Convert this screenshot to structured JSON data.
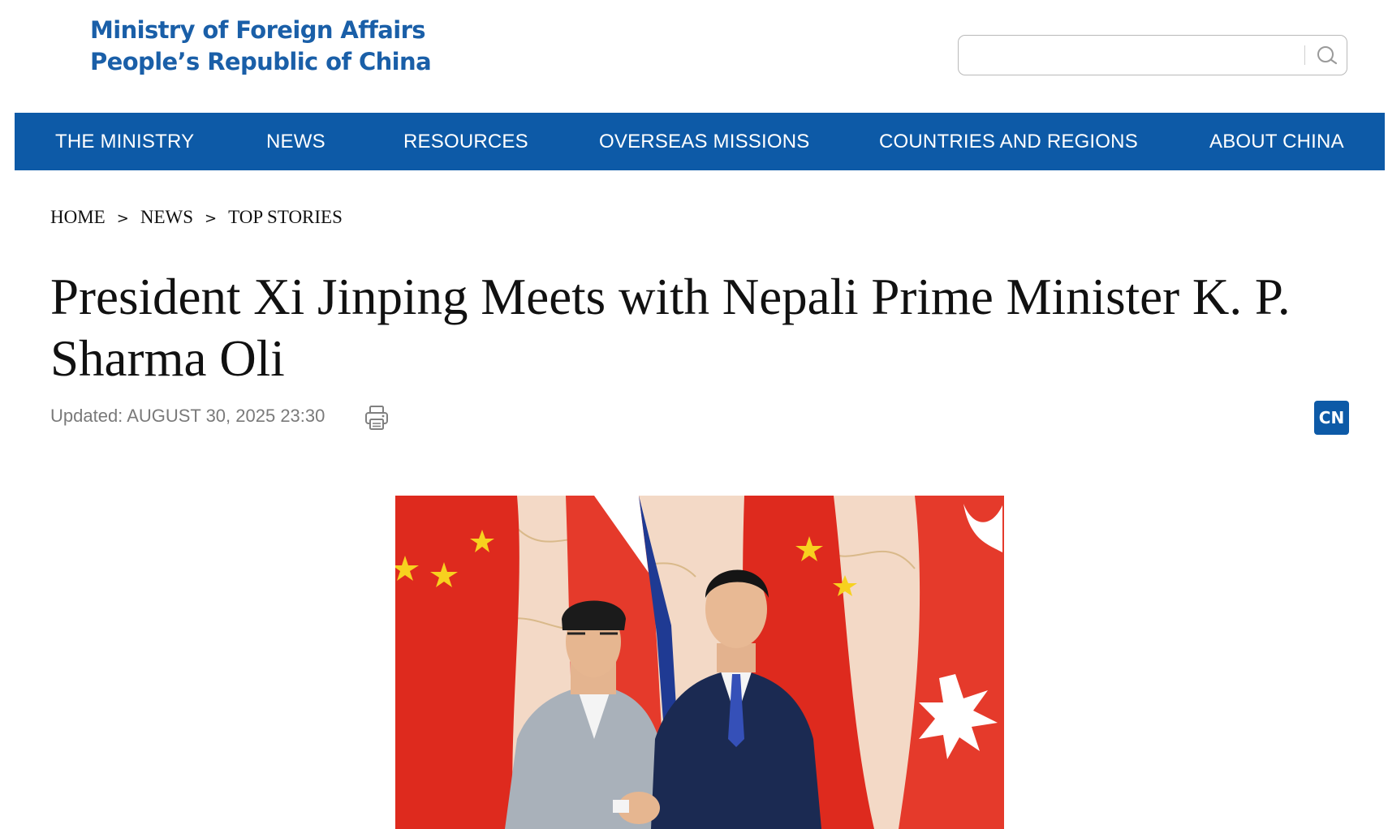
{
  "site": {
    "logo_line1": "Ministry of Foreign Affairs",
    "logo_line2": "People’s Republic of China",
    "brand_color": "#1a5fa8"
  },
  "search": {
    "placeholder": "",
    "value": "",
    "icon": "search-icon"
  },
  "nav": {
    "background": "#0d5aa7",
    "items": [
      {
        "label": "THE MINISTRY"
      },
      {
        "label": "NEWS"
      },
      {
        "label": "RESOURCES"
      },
      {
        "label": "OVERSEAS MISSIONS"
      },
      {
        "label": "COUNTRIES AND REGIONS"
      },
      {
        "label": "ABOUT CHINA"
      }
    ]
  },
  "breadcrumb": {
    "items": [
      {
        "label": "HOME"
      },
      {
        "label": "NEWS"
      },
      {
        "label": "TOP STORIES"
      }
    ],
    "separator": ">"
  },
  "article": {
    "title": "President Xi Jinping Meets with Nepali Prime Minister K. P. Sharma Oli",
    "updated_label": "Updated: AUGUST 30, 2025 23:30",
    "print_icon": "printer-icon",
    "language_button": "CN",
    "photo_icon": "photo-handshake"
  }
}
